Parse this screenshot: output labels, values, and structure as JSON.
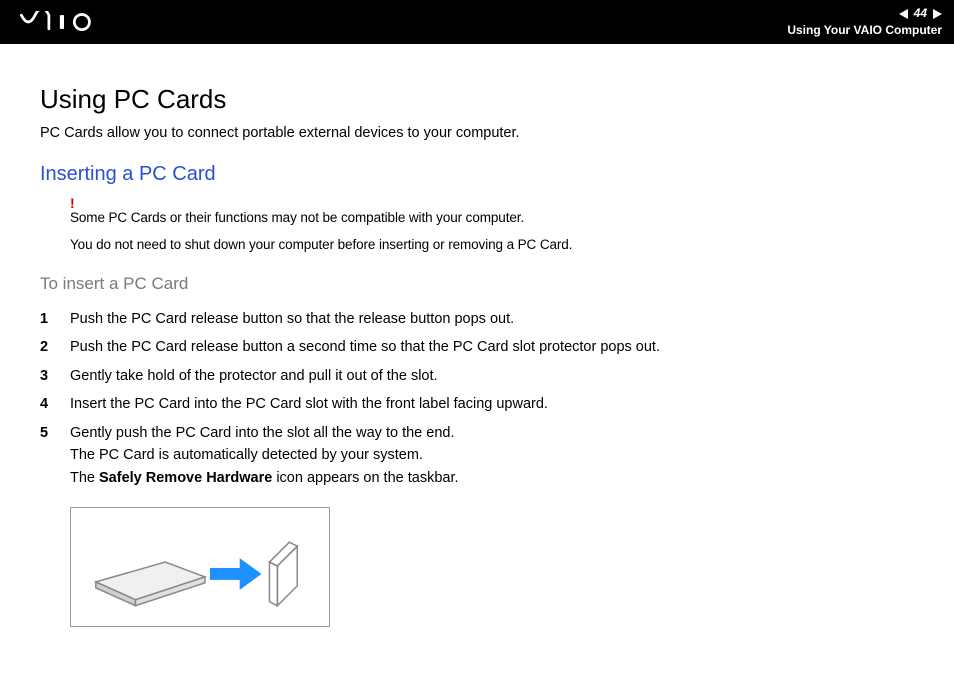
{
  "header": {
    "page_number": "44",
    "breadcrumb": "Using Your VAIO Computer"
  },
  "main": {
    "title": "Using PC Cards",
    "intro": "PC Cards allow you to connect portable external devices to your computer.",
    "section_title": "Inserting a PC Card",
    "notes": [
      "Some PC Cards or their functions may not be compatible with your computer.",
      "You do not need to shut down your computer before inserting or removing a PC Card."
    ],
    "subsection_title": "To insert a PC Card",
    "steps": [
      "Push the PC Card release button so that the release button pops out.",
      "Push the PC Card release button a second time so that the PC Card slot protector pops out.",
      "Gently take hold of the protector and pull it out of the slot.",
      "Insert the PC Card into the PC Card slot with the front label facing upward."
    ],
    "step5": {
      "line1": "Gently push the PC Card into the slot all the way to the end.",
      "line2": "The PC Card is automatically detected by your system.",
      "line3_a": "The ",
      "line3_b": "Safely Remove Hardware",
      "line3_c": " icon appears on the taskbar."
    }
  }
}
